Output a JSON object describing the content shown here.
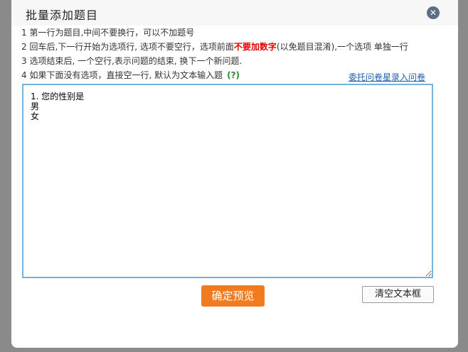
{
  "dialog": {
    "title": "批量添加题目",
    "close_symbol": "✕"
  },
  "instructions": {
    "line1": "1 第一行为题目,中间不要换行，可以不加题号",
    "line2_pre": "2 回车后,下一行开始为选项行, 选项不要空行，选项前面",
    "line2_emphasis": "不要加数字",
    "line2_post": "(以免题目混淆),一个选项 单独一行",
    "line3": "3 选项结束后, 一个空行,表示问题的结束, 换下一个新问题.",
    "line4": "4 如果下面没有选项，直接空一行, 默认为文本输入题",
    "help": "(?)"
  },
  "links": {
    "delegate": "委托问卷星录入问卷"
  },
  "editor": {
    "value": "1. 您的性别是\n男\n女"
  },
  "buttons": {
    "preview": "确定预览",
    "clear": "清空文本框"
  },
  "colors": {
    "accent": "#f27b1f",
    "emphasis": "#e60000",
    "link": "#1f5fa8",
    "help": "#2a8a2a",
    "editor_border": "#74b3e0"
  },
  "icons": {
    "close": "close-icon",
    "help": "help-icon",
    "resize": "resize-grip-icon"
  }
}
